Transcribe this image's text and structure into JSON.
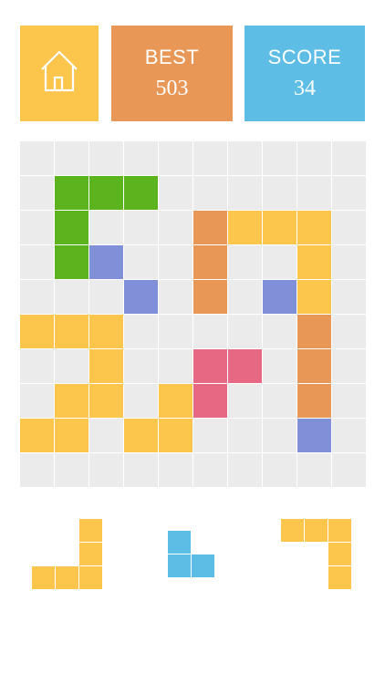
{
  "colors": {
    "home_tile": "#fcc54c",
    "best_tile": "#e99757",
    "score_tile": "#5ebde4",
    "empty_cell": "#ebebeb"
  },
  "home": {
    "icon": "home-icon"
  },
  "best": {
    "label": "BEST",
    "value": "503"
  },
  "score": {
    "label": "SCORE",
    "value": "34"
  },
  "board": {
    "cols": 10,
    "rows": 10,
    "palette": {
      "G": "#5bb31d",
      "Y": "#fcc54c",
      "O": "#e99757",
      "B": "#7f8fd8",
      "R": "#e76883"
    },
    "grid": [
      "..........",
      ".GGG......",
      ".G...OYYY.",
      ".GB..O..Y.",
      "...B.O.BY.",
      "YYY.....O.",
      "..Y..RR.O.",
      ".YY.YR..O.",
      "YY.YY...B.",
      ".........."
    ]
  },
  "pieces": [
    {
      "name": "piece-l-yellow",
      "color": "#fcc54c",
      "shape": [
        "..X",
        "..X",
        "XXX"
      ]
    },
    {
      "name": "piece-small-l-blue",
      "color": "#5ebde4",
      "shape": [
        "X.",
        "XX"
      ]
    },
    {
      "name": "piece-corner-yellow",
      "color": "#fcc54c",
      "shape": [
        "XXX",
        "..X",
        "..X"
      ]
    }
  ]
}
